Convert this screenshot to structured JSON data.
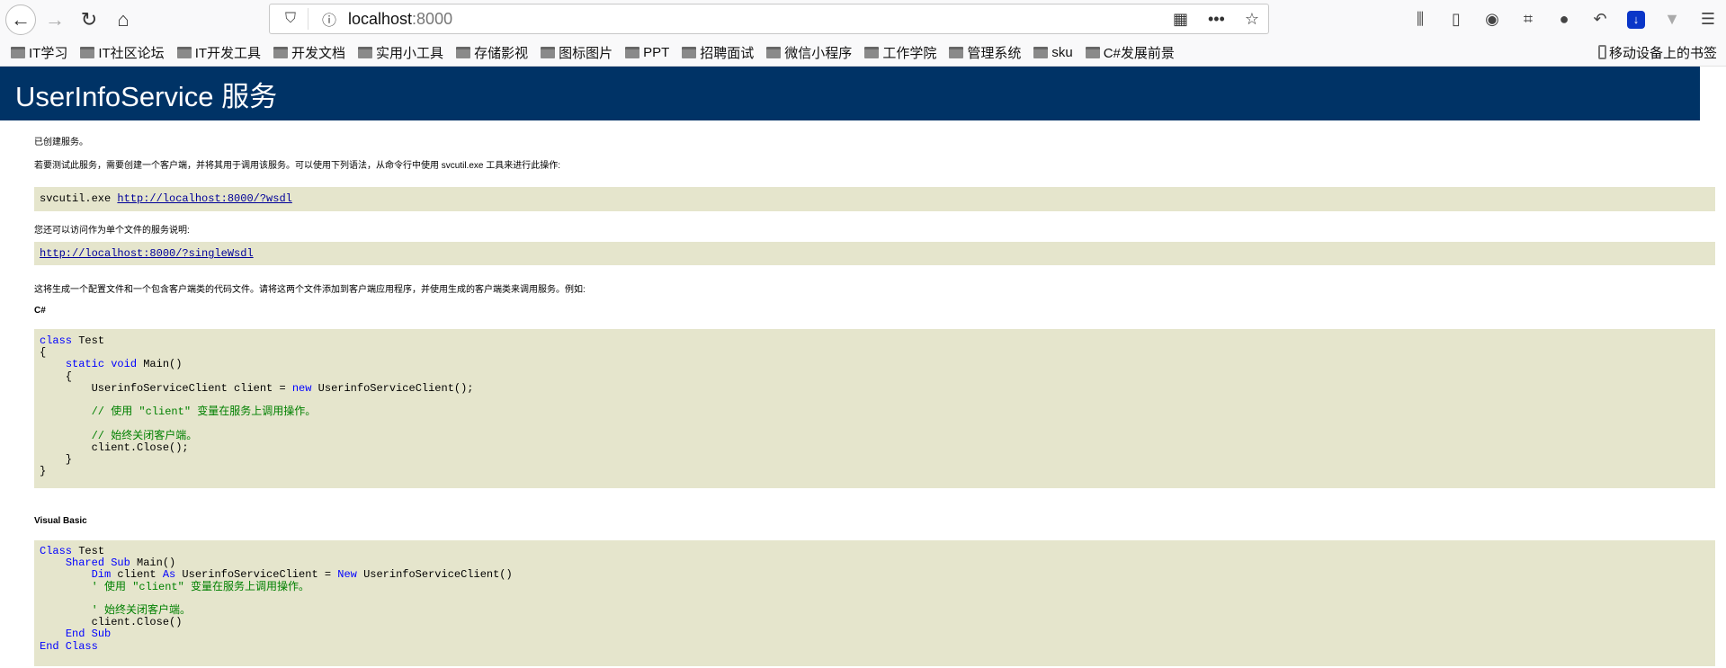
{
  "browser": {
    "url_host": "localhost",
    "url_port": ":8000",
    "toolbar_icons": [
      "library-icon",
      "sidebar-icon",
      "account-icon",
      "screenshot-crop-icon",
      "chat-icon",
      "undo-icon",
      "download-icon",
      "extension-v-icon",
      "menu-icon"
    ],
    "bookmarks": [
      "IT学习",
      "IT社区论坛",
      "IT开发工具",
      "开发文档",
      "实用小工具",
      "存储影视",
      "图标图片",
      "PPT",
      "招聘面试",
      "微信小程序",
      "工作学院",
      "管理系统",
      "sku",
      "C#发展前景"
    ],
    "mobile_bookmarks": "移动设备上的书签"
  },
  "page": {
    "title": "UserInfoService 服务",
    "header_color": "#003366",
    "code_bg": "#e5e5cc",
    "p1": "已创建服务。",
    "p2": "若要测试此服务，需要创建一个客户端，并将其用于调用该服务。可以使用下列语法，从命令行中使用 svcutil.exe 工具来进行此操作:",
    "svcutil_cmd": "svcutil.exe ",
    "wsdl_link": "http://localhost:8000/?wsdl",
    "p3": "您还可以访问作为单个文件的服务说明:",
    "single_wsdl_link": "http://localhost:8000/?singleWsdl",
    "p4": "这将生成一个配置文件和一个包含客户端类的代码文件。请将这两个文件添加到客户端应用程序，并使用生成的客户端类来调用服务。例如:",
    "csharp_label": "C#",
    "vb_label": "Visual Basic",
    "csharp_code": [
      [
        [
          "kw",
          "class"
        ],
        [
          "t",
          " Test"
        ]
      ],
      [
        [
          "t",
          "{"
        ]
      ],
      [
        [
          "t",
          "    "
        ],
        [
          "kw",
          "static void"
        ],
        [
          "t",
          " Main()"
        ]
      ],
      [
        [
          "t",
          "    {"
        ]
      ],
      [
        [
          "t",
          "        UserinfoServiceClient client = "
        ],
        [
          "kw",
          "new"
        ],
        [
          "t",
          " UserinfoServiceClient();"
        ]
      ],
      [
        [
          "t",
          ""
        ]
      ],
      [
        [
          "t",
          "        "
        ],
        [
          "cm",
          "// 使用 \"client\" 变量在服务上调用操作。"
        ]
      ],
      [
        [
          "t",
          ""
        ]
      ],
      [
        [
          "t",
          "        "
        ],
        [
          "cm",
          "// 始终关闭客户端。"
        ]
      ],
      [
        [
          "t",
          "        client.Close();"
        ]
      ],
      [
        [
          "t",
          "    }"
        ]
      ],
      [
        [
          "t",
          "}"
        ]
      ]
    ],
    "vb_code": [
      [
        [
          "kw",
          "Class"
        ],
        [
          "t",
          " Test"
        ]
      ],
      [
        [
          "t",
          "    "
        ],
        [
          "kw",
          "Shared Sub"
        ],
        [
          "t",
          " Main()"
        ]
      ],
      [
        [
          "t",
          "        "
        ],
        [
          "kw",
          "Dim"
        ],
        [
          "t",
          " client "
        ],
        [
          "kw",
          "As"
        ],
        [
          "t",
          " UserinfoServiceClient = "
        ],
        [
          "kw",
          "New"
        ],
        [
          "t",
          " UserinfoServiceClient()"
        ]
      ],
      [
        [
          "t",
          "        "
        ],
        [
          "cm",
          "' 使用 \"client\" 变量在服务上调用操作。"
        ]
      ],
      [
        [
          "t",
          ""
        ]
      ],
      [
        [
          "t",
          "        "
        ],
        [
          "cm",
          "' 始终关闭客户端。"
        ]
      ],
      [
        [
          "t",
          "        client.Close()"
        ]
      ],
      [
        [
          "t",
          "    "
        ],
        [
          "kw",
          "End Sub"
        ]
      ],
      [
        [
          "kw",
          "End Class"
        ]
      ]
    ]
  }
}
